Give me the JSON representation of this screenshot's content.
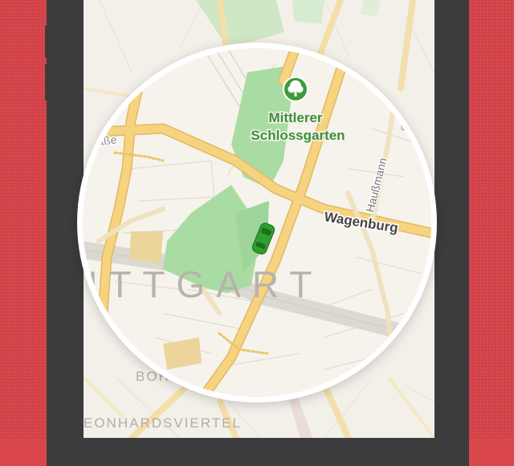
{
  "map": {
    "labels": {
      "park": "Mittlerer Schlossgarten",
      "park_line1": "Mittlerer",
      "park_line2": "Schlossgarten",
      "city": "UTTGART",
      "street_east": "Wagenburg",
      "street_north": "Haußmann",
      "street_northeast": "Straße",
      "street_west": "enstraße",
      "district_south": "BOHNENVIERTEL",
      "district_bottom": "EONHARDSVIERTEL"
    },
    "icons": {
      "park": "tree-icon",
      "vehicle": "car-icon"
    },
    "colors": {
      "background": "#d9474c",
      "device": "#3c3c3e",
      "park": "#a9dca2",
      "park_text": "#3b8f3a",
      "road_major": "#f6d37f",
      "road_outline": "#e4b863",
      "vehicle": "#2e9f2e"
    }
  }
}
